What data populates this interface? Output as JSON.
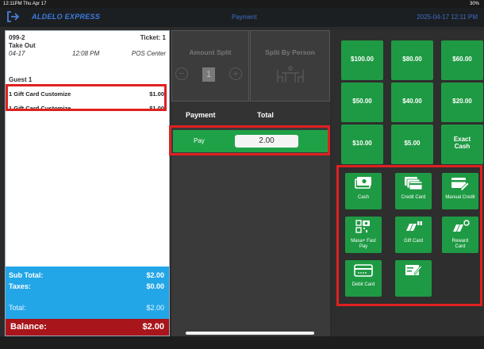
{
  "status": {
    "time": "12:11PM  Thu Apr 17",
    "battery": "30%"
  },
  "topbar": {
    "brand": "ALDELO EXPRESS",
    "title": "Payment",
    "datetime": "2025-04-17 12:11 PM"
  },
  "ticket": {
    "order_number": "099-2",
    "ticket_label": "Ticket: 1",
    "order_type": "Take Out",
    "date": "04-17",
    "time": "12:08 PM",
    "station": "POS Center",
    "guest": "Guest 1",
    "items": [
      {
        "name": "1 Gift Card Customize",
        "price": "$1.00"
      },
      {
        "name": "1 Gift Card Customize",
        "price": "$1.00"
      }
    ],
    "subtotal_label": "Sub Total:",
    "subtotal": "$2.00",
    "taxes_label": "Taxes:",
    "taxes": "$0.00",
    "total_label": "Total:",
    "total": "$2.00",
    "balance_label": "Balance:",
    "balance": "$2.00"
  },
  "split": {
    "amount_split": "Amount Split",
    "split_by_person": "Split By Person",
    "count": "1"
  },
  "payment": {
    "col_payment": "Payment",
    "col_total": "Total",
    "pay_label": "Pay",
    "pay_amount": "2.00"
  },
  "quick_amounts": [
    "$100.00",
    "$80.00",
    "$60.00",
    "$50.00",
    "$40.00",
    "$20.00",
    "$10.00",
    "$5.00",
    "Exact Cash"
  ],
  "methods": [
    {
      "label": "Cash",
      "icon": "cash-icon"
    },
    {
      "label": "Credit Card",
      "icon": "credit-card-icon"
    },
    {
      "label": "Manual Credit",
      "icon": "manual-credit-icon"
    },
    {
      "label": "Masa+ Fast Pay",
      "icon": "qr-code-icon"
    },
    {
      "label": "Gift Card",
      "icon": "gift-card-icon"
    },
    {
      "label": "Reward Card",
      "icon": "reward-card-icon"
    },
    {
      "label": "Debit Card",
      "icon": "debit-card-icon"
    },
    {
      "label": "",
      "icon": "check-icon"
    }
  ],
  "colors": {
    "green": "#1f9a44",
    "blue": "#22a6e8",
    "red": "#a8151a",
    "highlight": "#e02020"
  }
}
